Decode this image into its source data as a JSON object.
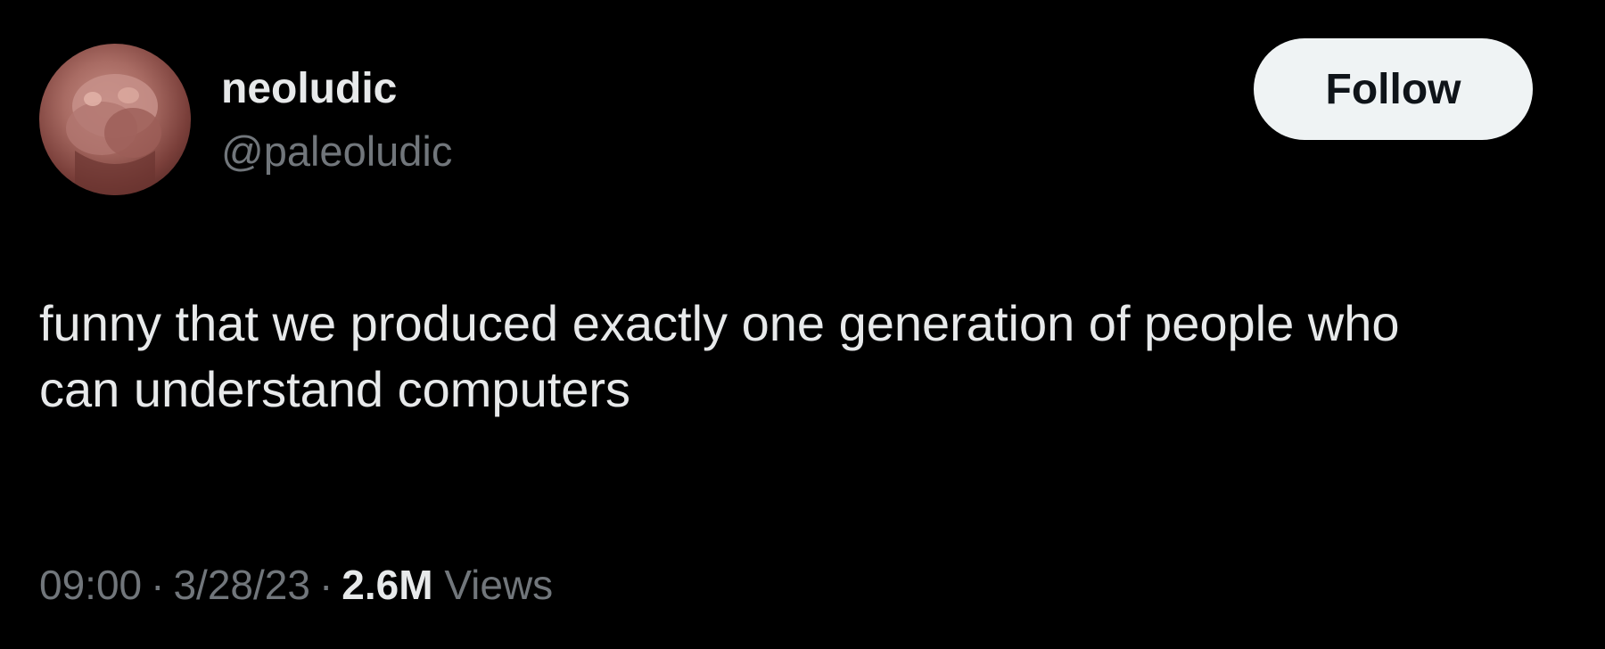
{
  "author": {
    "display_name": "neoludic",
    "handle": "@paleoludic",
    "avatar_icon": "avatar-photo"
  },
  "follow_button": {
    "label": "Follow"
  },
  "tweet": {
    "text": "funny that we produced exactly one generation of people who can understand computers"
  },
  "meta": {
    "time": "09:00",
    "separator": "·",
    "date": "3/28/23",
    "views_count": "2.6M",
    "views_label": "Views"
  },
  "colors": {
    "background": "#000000",
    "primary_text": "#e7e9ea",
    "secondary_text": "#71767b",
    "follow_bg": "#eff3f4",
    "follow_text": "#0f1419"
  }
}
